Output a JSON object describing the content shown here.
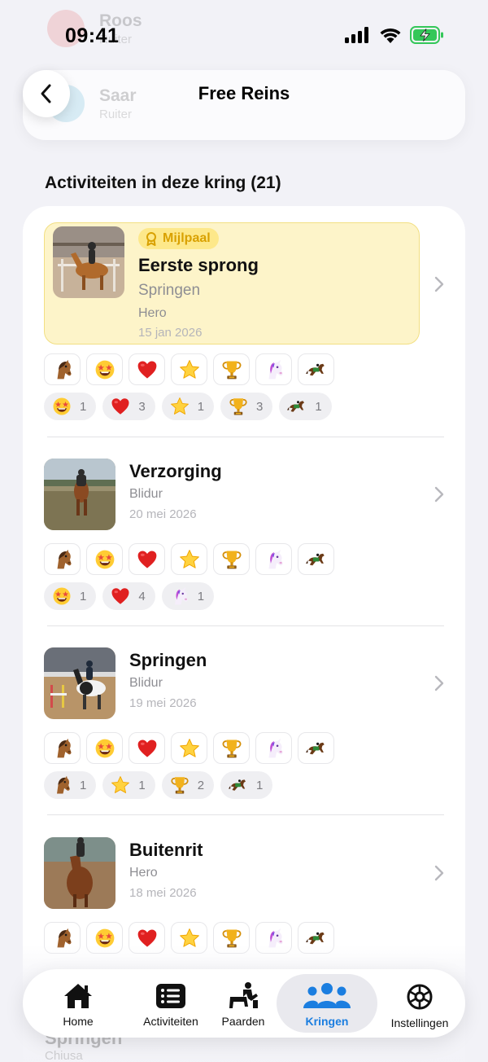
{
  "status_bar": {
    "time": "09:41"
  },
  "background_members": [
    {
      "name": "Roos",
      "role": "Ruiter"
    },
    {
      "name": "Saar",
      "role": "Ruiter"
    }
  ],
  "header": {
    "title": "Free Reins"
  },
  "section": {
    "heading": "Activiteiten in deze kring (21)"
  },
  "reaction_set": [
    "horse-face",
    "star-struck",
    "red-heart",
    "star",
    "trophy",
    "unicorn",
    "racehorse"
  ],
  "activities": [
    {
      "badge": "Mijlpaal",
      "title": "Eerste sprong",
      "subtitle": "Springen",
      "horse": "Hero",
      "date": "15 jan 2026",
      "counts": [
        {
          "emoji": "star-struck",
          "count": "1"
        },
        {
          "emoji": "red-heart",
          "count": "3"
        },
        {
          "emoji": "star",
          "count": "1"
        },
        {
          "emoji": "trophy",
          "count": "3"
        },
        {
          "emoji": "racehorse",
          "count": "1"
        }
      ]
    },
    {
      "title": "Verzorging",
      "horse": "Blidur",
      "date": "20 mei 2026",
      "counts": [
        {
          "emoji": "star-struck",
          "count": "1"
        },
        {
          "emoji": "red-heart",
          "count": "4"
        },
        {
          "emoji": "unicorn",
          "count": "1"
        }
      ]
    },
    {
      "title": "Springen",
      "horse": "Blidur",
      "date": "19 mei 2026",
      "counts": [
        {
          "emoji": "horse-face",
          "count": "1"
        },
        {
          "emoji": "star",
          "count": "1"
        },
        {
          "emoji": "trophy",
          "count": "2"
        },
        {
          "emoji": "racehorse",
          "count": "1"
        }
      ]
    },
    {
      "title": "Buitenrit",
      "horse": "Hero",
      "date": "18 mei 2026",
      "counts": []
    }
  ],
  "peek_item": {
    "title": "Springen",
    "horse": "Chiusa"
  },
  "tab_bar": {
    "tabs": [
      {
        "label": "Home",
        "icon": "home-icon"
      },
      {
        "label": "Activiteiten",
        "icon": "list-icon"
      },
      {
        "label": "Paarden",
        "icon": "rider-icon"
      },
      {
        "label": "Kringen",
        "icon": "group-icon",
        "active": true
      },
      {
        "label": "Instellingen",
        "icon": "gear-icon"
      }
    ]
  },
  "colors": {
    "accent": "#1b7ee0",
    "milestone_bg": "#fdf4c9",
    "milestone_badge": "#fde88a",
    "milestone_text": "#d9a100",
    "battery": "#34c759"
  }
}
